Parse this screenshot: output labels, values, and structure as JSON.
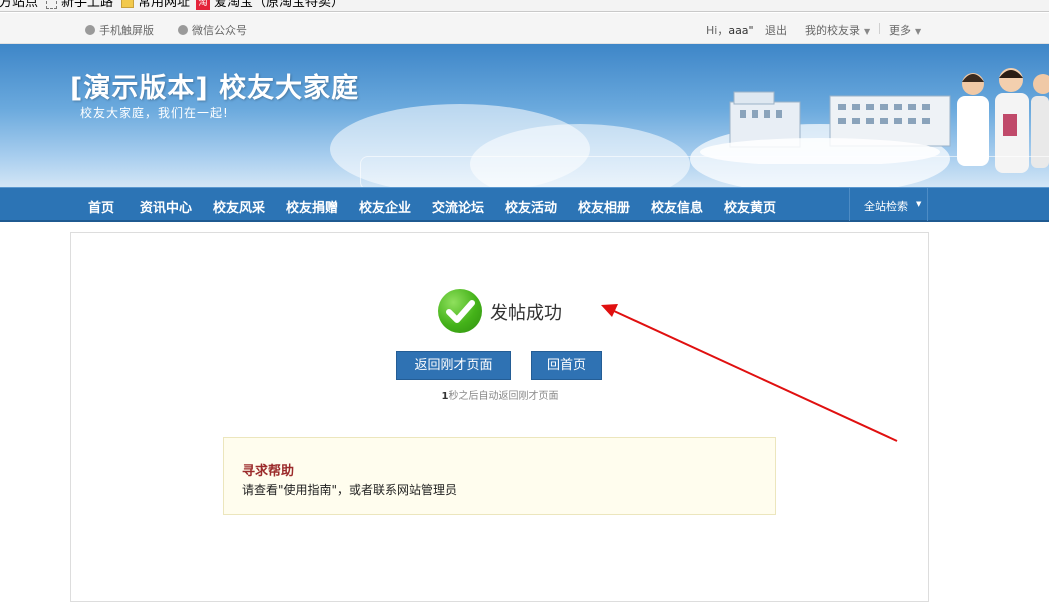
{
  "bookmarks": [
    {
      "label": "官方站点"
    },
    {
      "label": "新手上路"
    },
    {
      "label": "常用网址"
    },
    {
      "label": "爱淘宝（原淘宝特卖）"
    }
  ],
  "topbar": {
    "mobile": "手机触屏版",
    "wechat": "微信公众号",
    "greeting": "Hi，",
    "username": "aaa\"",
    "logout": "退出",
    "alumni_record": "我的校友录",
    "more": "更多"
  },
  "header": {
    "title": "[演示版本] 校友大家庭",
    "slogan": "校友大家庭，我们在一起!"
  },
  "nav": {
    "items": [
      "首页",
      "资讯中心",
      "校友风采",
      "校友捐赠",
      "校友企业",
      "交流论坛",
      "校友活动",
      "校友相册",
      "校友信息",
      "校友黄页"
    ],
    "search": "全站检索"
  },
  "result": {
    "message": "发帖成功",
    "back_button": "返回刚才页面",
    "home_button": "回首页",
    "countdown_seconds": "1",
    "countdown_text": "秒之后自动返回刚才页面"
  },
  "help": {
    "title": "寻求帮助",
    "text": "请查看\"使用指南\"，或者联系网站管理员"
  },
  "colors": {
    "nav_blue": "#2c74b5",
    "button_blue": "#2f72b3",
    "success_green": "#44b219",
    "help_title_red": "#9b2b2b",
    "arrow_red": "#e01010"
  }
}
